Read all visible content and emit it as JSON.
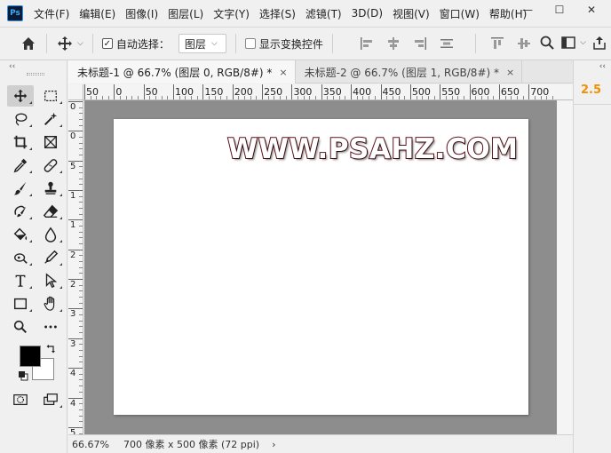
{
  "app": {
    "logo_text": "Ps"
  },
  "menu": {
    "items": [
      "文件(F)",
      "编辑(E)",
      "图像(I)",
      "图层(L)",
      "文字(Y)",
      "选择(S)",
      "滤镜(T)",
      "3D(D)",
      "视图(V)",
      "窗口(W)",
      "帮助(H)"
    ]
  },
  "window_controls": {
    "minimize": "—",
    "restore": "☐",
    "close": "✕"
  },
  "options": {
    "auto_select_label": "自动选择：",
    "auto_select_checked": true,
    "auto_select_check_glyph": "✓",
    "layer_select_value": "图层",
    "show_transform_label": "显示变换控件",
    "show_transform_checked": false,
    "caret": "⌵",
    "more_glyph": "⌵"
  },
  "tabs": [
    {
      "label": "未标题-1 @ 66.7% (图层 0, RGB/8#) *",
      "active": true,
      "close": "×"
    },
    {
      "label": "未标题-2 @ 66.7% (图层 1, RGB/8#) *",
      "active": false,
      "close": "×"
    }
  ],
  "right_panel": {
    "value": "2.5",
    "collapse": "‹‹"
  },
  "toolbar": {
    "collapse": "‹‹"
  },
  "ruler": {
    "h_labels": [
      "50",
      "0",
      "50",
      "100",
      "150",
      "200",
      "250",
      "300",
      "350",
      "400",
      "450",
      "500",
      "550",
      "600",
      "650",
      "700"
    ],
    "v_labels": [
      "0",
      "0",
      "5",
      "1",
      "1",
      "2",
      "2",
      "3",
      "3",
      "4",
      "4",
      "5"
    ]
  },
  "canvas": {
    "text": "WWW.PSAHZ.COM",
    "stroke_color": "#5a0f14",
    "fill_color": "#ffffff"
  },
  "colors": {
    "foreground": "#000000",
    "background": "#ffffff",
    "workspace": "#8d8d8d",
    "accent_value": "#f29100"
  },
  "status": {
    "zoom": "66.67%",
    "doc_info": "700 像素 x 500 像素 (72 ppi)",
    "arrow": "›"
  }
}
